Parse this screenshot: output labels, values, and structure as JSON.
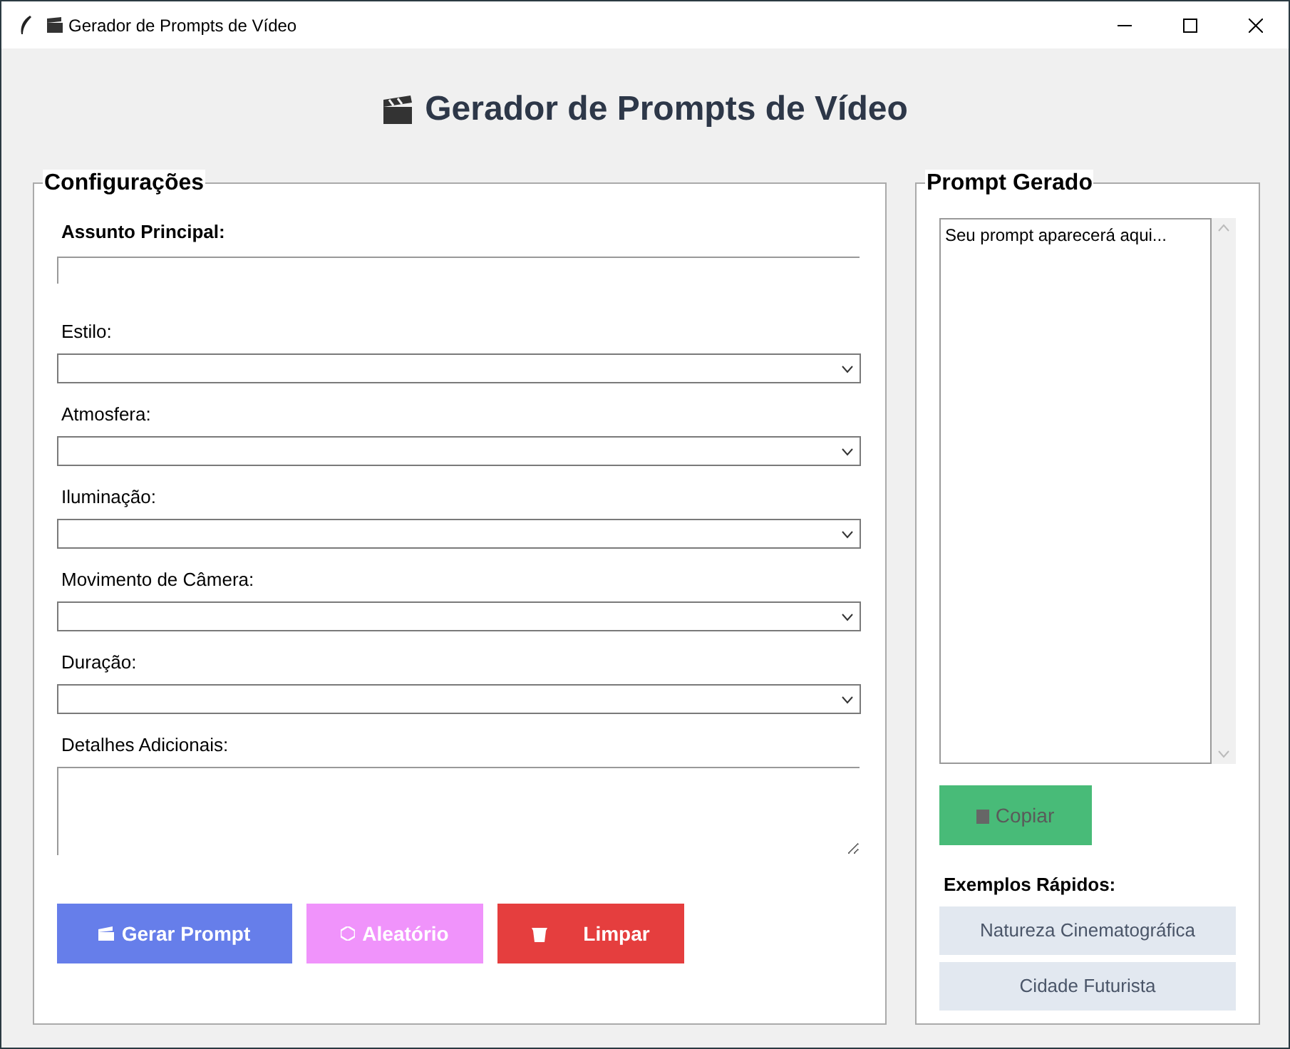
{
  "window": {
    "title": "Gerador de Prompts de Vídeo"
  },
  "header": {
    "title": "Gerador de Prompts de Vídeo"
  },
  "config": {
    "title": "Configurações",
    "fields": [
      {
        "kind": "entry",
        "label": "Assunto Principal:",
        "bold": true
      },
      {
        "kind": "combo",
        "label": "Estilo:",
        "bold": false
      },
      {
        "kind": "combo",
        "label": "Atmosfera:",
        "bold": false
      },
      {
        "kind": "combo",
        "label": "Iluminação:",
        "bold": false
      },
      {
        "kind": "combo",
        "label": "Movimento de Câmera:",
        "bold": false
      },
      {
        "kind": "combo",
        "label": "Duração:",
        "bold": false
      },
      {
        "kind": "text",
        "label": "Detalhes Adicionais:",
        "bold": false
      }
    ],
    "buttons": [
      {
        "label": "Gerar Prompt",
        "color": "#667eea"
      },
      {
        "label": "Aleatório",
        "color": "#f093fb"
      },
      {
        "label": "Limpar",
        "color": "#e53e3e"
      }
    ]
  },
  "output": {
    "title": "Prompt Gerado",
    "text": "Seu prompt aparecerá aqui...",
    "copy_button": {
      "label": "Copiar",
      "disabled": true
    },
    "examples_title": "Exemplos Rápidos:",
    "examples": [
      "Natureza Cinematográfica",
      "Cidade Futurista"
    ]
  }
}
